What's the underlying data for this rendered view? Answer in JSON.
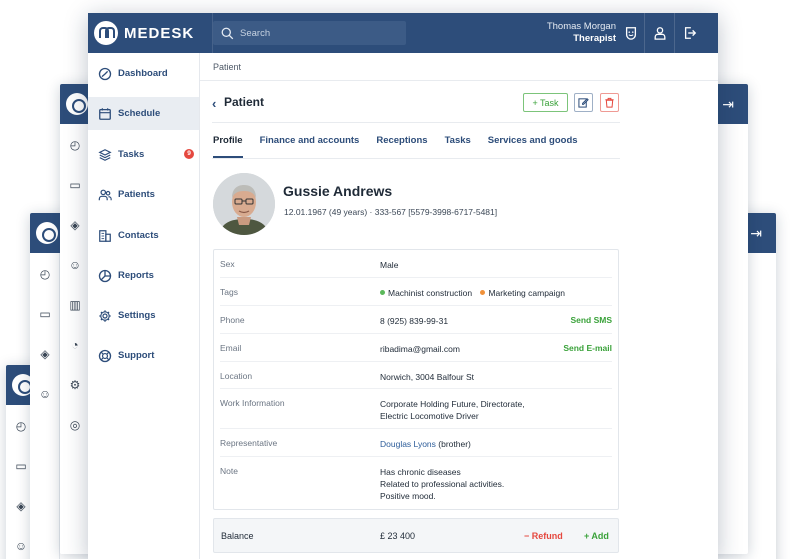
{
  "app": {
    "name": "MEDESK"
  },
  "search": {
    "placeholder": "Search"
  },
  "user": {
    "name": "Thomas Morgan",
    "role": "Therapist"
  },
  "sidebar": {
    "items": [
      {
        "label": "Dashboard",
        "icon": "dashboard-icon"
      },
      {
        "label": "Schedule",
        "icon": "calendar-icon",
        "active": true
      },
      {
        "label": "Tasks",
        "icon": "layers-icon",
        "badge": "9"
      },
      {
        "label": "Patients",
        "icon": "users-icon"
      },
      {
        "label": "Contacts",
        "icon": "building-icon"
      },
      {
        "label": "Reports",
        "icon": "pie-chart-icon"
      },
      {
        "label": "Settings",
        "icon": "gear-icon"
      },
      {
        "label": "Support",
        "icon": "lifebuoy-icon"
      }
    ]
  },
  "breadcrumb": "Patient",
  "header": {
    "title": "Patient",
    "task_button": "+ Task"
  },
  "tabs": [
    "Profile",
    "Finance and accounts",
    "Receptions",
    "Tasks",
    "Services and goods"
  ],
  "patient": {
    "name": "Gussie Andrews",
    "meta": "12.01.1967 (49 years)  ·  333-567 [5579-3998-6717-5481]"
  },
  "details": {
    "sex": {
      "label": "Sex",
      "value": "Male"
    },
    "tags": {
      "label": "Tags",
      "items": [
        {
          "text": "Machinist construction",
          "color": "#5bb85b"
        },
        {
          "text": "Marketing campaign",
          "color": "#f0913a"
        }
      ]
    },
    "phone": {
      "label": "Phone",
      "value": "8 (925) 839-99-31",
      "action": "Send SMS"
    },
    "email": {
      "label": "Email",
      "value": "ribadima@gmail.com",
      "action": "Send E-mail"
    },
    "location": {
      "label": "Location",
      "value": "Norwich, 3004 Balfour St"
    },
    "work": {
      "label": "Work Information",
      "line1": "Corporate Holding Future, Directorate,",
      "line2": "Electric Locomotive Driver"
    },
    "representative": {
      "label": "Representative",
      "name": "Douglas Lyons",
      "relation": "(brother)"
    },
    "note": {
      "label": "Note",
      "line1": "Has chronic diseases",
      "line2": "Related to professional activities.",
      "line3": "Positive mood."
    }
  },
  "balance": {
    "label": "Balance",
    "value": "£ 23 400",
    "refund": "− Refund",
    "add": "+ Add"
  },
  "colors": {
    "primary": "#2d4d7a",
    "success": "#3aa23a",
    "danger": "#e5483f"
  }
}
